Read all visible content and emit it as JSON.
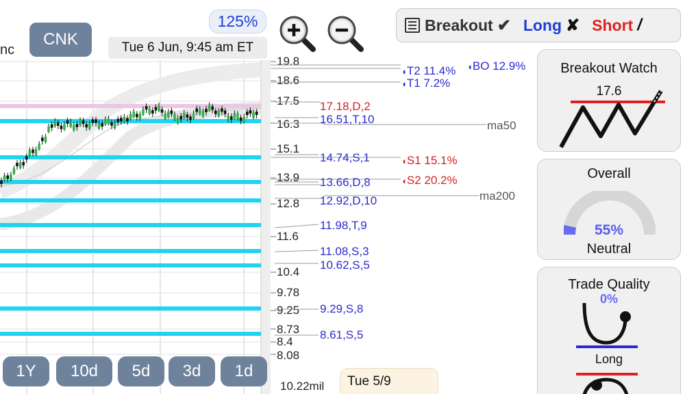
{
  "header": {
    "company_suffix": "nc",
    "ticker": "CNK",
    "datetime": "Tue 6 Jun, 9:45 am ET",
    "zoom": "125%"
  },
  "toolbar": {
    "zoom_in_icon": "zoom-in-magnifier-icon",
    "zoom_out_icon": "zoom-out-magnifier-icon"
  },
  "strategy": {
    "menu_icon": "list-icon",
    "breakout_label": "Breakout",
    "breakout_mark": "✔",
    "long_label": "Long",
    "long_mark": "✘",
    "short_label": "Short",
    "short_mark": "/",
    "colors": {
      "breakout": "#333333",
      "long": "#1f3fd4",
      "short": "#e02020"
    }
  },
  "price_axis": [
    "19.8",
    "18.6",
    "17.5",
    "16.3",
    "15.1",
    "13.9",
    "12.8",
    "11.6",
    "10.4",
    "9.78",
    "9.25",
    "8.73",
    "8.4",
    "8.08"
  ],
  "levels": [
    {
      "text": "17.18,D,2",
      "color": "#d42020"
    },
    {
      "text": "16.51,T,10",
      "color": "#2a2ad0"
    },
    {
      "text": "14.74,S,1",
      "color": "#2a2ad0"
    },
    {
      "text": "13.66,D,8",
      "color": "#2a2ad0"
    },
    {
      "text": "12.92,D,10",
      "color": "#2a2ad0"
    },
    {
      "text": "11.98,T,9",
      "color": "#2a2ad0"
    },
    {
      "text": "11.08,S,3",
      "color": "#2a2ad0"
    },
    {
      "text": "10.62,S,5",
      "color": "#2a2ad0"
    },
    {
      "text": "9.29,S,8",
      "color": "#2a2ad0"
    },
    {
      "text": "8.61,S,5",
      "color": "#2a2ad0"
    }
  ],
  "moving_averages": {
    "ma50": "ma50",
    "ma200": "ma200"
  },
  "targets": [
    {
      "text": "T2 11.4%",
      "color": "#2a2ad0"
    },
    {
      "text": "BO 12.9%",
      "color": "#2a2ad0"
    },
    {
      "text": "T1 7.2%",
      "color": "#2a2ad0"
    },
    {
      "text": "S1 15.1%",
      "color": "#d42020"
    },
    {
      "text": "S2 20.2%",
      "color": "#d42020"
    }
  ],
  "periods": [
    "1Y",
    "10d",
    "5d",
    "3d",
    "1d"
  ],
  "volume": "10.22mil",
  "tooltip_date": "Tue 5/9",
  "cards": {
    "breakout_watch": {
      "title": "Breakout Watch",
      "value": "17.6"
    },
    "overall": {
      "title": "Overall",
      "percent": 55,
      "percent_text": "55%",
      "verdict": "Neutral"
    },
    "trade_quality": {
      "title": "Trade Quality",
      "percent_text": "0%",
      "side": "Long"
    }
  }
}
